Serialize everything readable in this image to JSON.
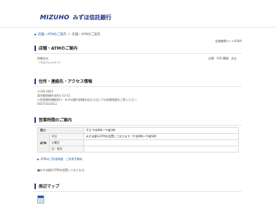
{
  "header": {
    "logo_latin": "MIZUHO",
    "logo_jp": "みずほ信託銀行"
  },
  "breadcrumb": {
    "item1": "店舗・ATMのご案内",
    "item2": "店舗・ATMのご案内"
  },
  "bank_code": "金融機関コード0289",
  "page_title": "店舗・ATMのご案内",
  "branch": {
    "name": "前橋支店",
    "kana": "（マエバシシテン）",
    "store_no": "店番：036 種類：支店"
  },
  "address_section": {
    "title": "住所・連絡先・アクセス情報",
    "postal": "〒164-0022",
    "address": "東京都前橋市本町1-13-15",
    "access": "小田急線前橋駅西口・みずほ銀行前橋支店ならびに下の詳細地図をご覧ください",
    "phone": "0427(35)1611"
  },
  "hours_section": {
    "title": "営業時間のご案内",
    "rows": [
      {
        "label": "窓口",
        "sub": "",
        "value": "平日 午前9時〜午後3時"
      },
      {
        "label": "ATM",
        "sub": "平日",
        "value": "みずほ銀行ATMを設置しております（午前9時〜午後5時）"
      },
      {
        "label": "",
        "sub": "土曜日",
        "value": ""
      },
      {
        "label": "",
        "sub": "日・祝日",
        "value": ""
      }
    ],
    "link_text": "ATMのご利用時間、ご利用手数料",
    "note": "■みずほ銀行ATMを設置しております。"
  },
  "map_section": {
    "title": "周辺マップ"
  }
}
